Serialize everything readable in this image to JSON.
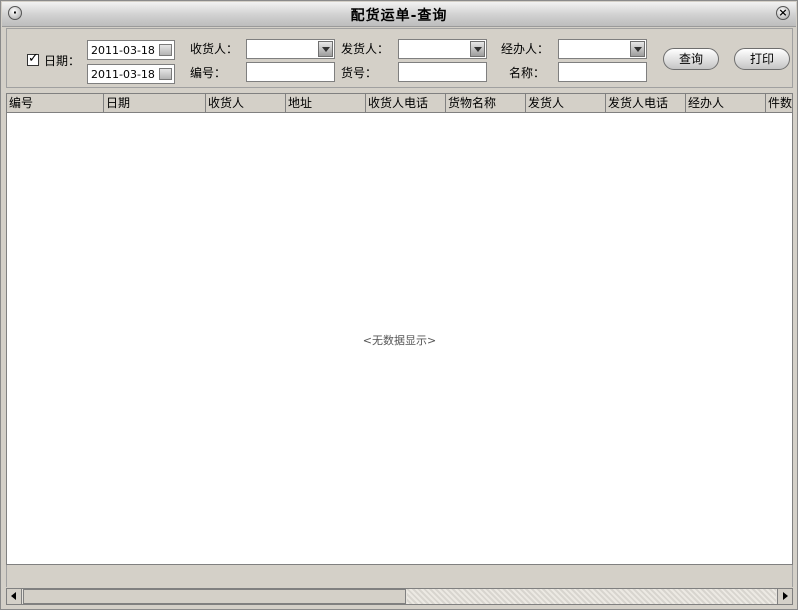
{
  "window": {
    "title": "配货运单-查询"
  },
  "filters": {
    "date_label": "日期：",
    "date_from": "2011-03-18",
    "date_to": "2011-03-18",
    "date_checked": true,
    "receiver_label": "收货人：",
    "receiver_value": "",
    "sender_label": "发货人：",
    "sender_value": "",
    "handler_label": "经办人：",
    "handler_value": "",
    "number_label": "编号：",
    "number_value": "",
    "goods_no_label": "货号：",
    "goods_no_value": "",
    "name_label": "名称：",
    "name_value": ""
  },
  "buttons": {
    "query": "查询",
    "print": "打印"
  },
  "table": {
    "columns": [
      "编号",
      "日期",
      "收货人",
      "地址",
      "收货人电话",
      "货物名称",
      "发货人",
      "发货人电话",
      "经办人",
      "件数"
    ],
    "empty_text": "<无数据显示>"
  },
  "colors": {
    "window_bg": "#d4d0c8",
    "grid_bg": "#ffffff",
    "border": "#808080"
  },
  "icons": {
    "system_menu": "system-menu-icon",
    "close": "close-icon",
    "calendar": "calendar-icon",
    "dropdown": "dropdown-arrow-icon"
  }
}
